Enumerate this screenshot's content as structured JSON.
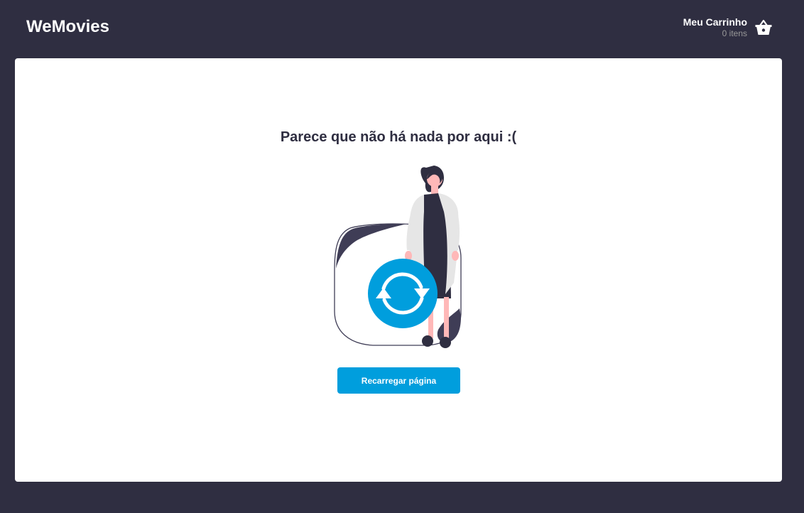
{
  "header": {
    "logo": "WeMovies",
    "cart": {
      "title": "Meu Carrinho",
      "count_label": "0 itens",
      "icon": "basket-icon"
    }
  },
  "main": {
    "empty_state": {
      "title": "Parece que não há nada por aqui :(",
      "illustration": "woman-with-reload-illustration",
      "reload_button_label": "Recarregar página"
    }
  },
  "colors": {
    "background": "#2F2E41",
    "card": "#FFFFFF",
    "accent": "#009EDD",
    "text_dark": "#2F2E41",
    "muted": "#999999"
  }
}
